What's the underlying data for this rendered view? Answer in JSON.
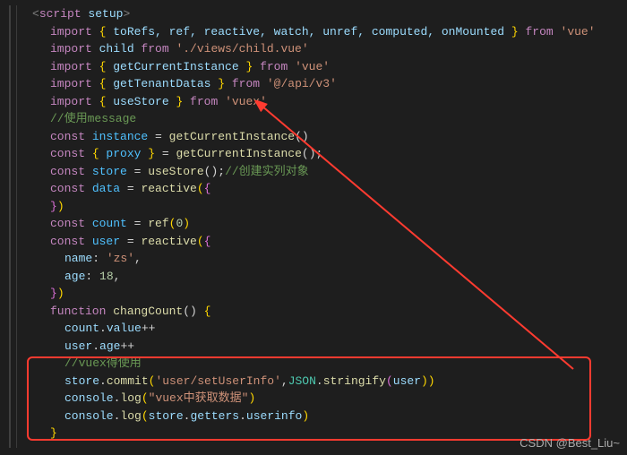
{
  "code": {
    "l1": {
      "tag_open": "<",
      "tag": "script",
      "attr": " setup",
      "tag_close": ">"
    },
    "l2": {
      "imp": "import",
      "b1": " { ",
      "names": "toRefs, ref, reactive, watch, unref, computed, onMounted",
      "b2": " } ",
      "from": "from ",
      "mod": "'vue'"
    },
    "l3": {
      "imp": "import",
      "name": " child ",
      "from": "from ",
      "mod": "'./views/child.vue'"
    },
    "l4": {
      "imp": "import",
      "b1": " { ",
      "names": "getCurrentInstance",
      "b2": " } ",
      "from": "from ",
      "mod": "'vue'"
    },
    "l5": {
      "imp": "import",
      "b1": " { ",
      "names": "getTenantDatas",
      "b2": " } ",
      "from": "from ",
      "mod": "'@/api/v3'"
    },
    "l6": {
      "imp": "import",
      "b1": " { ",
      "names": "useStore",
      "b2": " } ",
      "from": "from ",
      "mod": "'vuex'"
    },
    "l7": {
      "c": "//使用message"
    },
    "l8": {
      "kw": "const ",
      "v": "instance",
      "eq": " = ",
      "fn": "getCurrentInstance",
      "call": "()"
    },
    "l9": {
      "kw": "const ",
      "b1": "{ ",
      "v": "proxy",
      "b2": " }",
      "eq": " = ",
      "fn": "getCurrentInstance",
      "call": "();"
    },
    "l10": {
      "kw": "const ",
      "v": "store",
      "eq": " = ",
      "fn": "useStore",
      "call": "();",
      "c": "//创建实列对象"
    },
    "l11": {
      "kw": "const ",
      "v": "data",
      "eq": " = ",
      "fn": "reactive",
      "p1": "(",
      "b1": "{"
    },
    "l12": "",
    "l13": {
      "b2": "}",
      "p2": ")"
    },
    "l14": {
      "kw": "const ",
      "v": "count",
      "eq": " = ",
      "fn": "ref",
      "p1": "(",
      "n": "0",
      "p2": ")"
    },
    "l15": {
      "kw": "const ",
      "v": "user",
      "eq": " = ",
      "fn": "reactive",
      "p1": "(",
      "b1": "{"
    },
    "l16": {
      "k": "name",
      "c": ": ",
      "s": "'zs'",
      "comma": ","
    },
    "l17": {
      "k": "age",
      "c": ": ",
      "n": "18",
      "comma": ","
    },
    "l18": {
      "b2": "}",
      "p2": ")"
    },
    "l19": {
      "kw": "function ",
      "fn": "changCount",
      "p": "() ",
      "b1": "{"
    },
    "l20": {
      "v": "count",
      "d": ".",
      "p": "value",
      "op": "++"
    },
    "l21": {
      "v": "user",
      "d": ".",
      "p": "age",
      "op": "++"
    },
    "l22": {
      "c": "//vuex得使用"
    },
    "l23": {
      "v": "store",
      "d1": ".",
      "m": "commit",
      "p1": "(",
      "s1": "'user/setUserInfo'",
      "comma": ",",
      "cls": "JSON",
      "d2": ".",
      "m2": "stringify",
      "p2": "(",
      "arg": "user",
      "p3": "))"
    },
    "l24": {
      "v": "console",
      "d1": ".",
      "m": "log",
      "p1": "(",
      "s1": "\"vuex中获取数据\"",
      "p2": ")"
    },
    "l25": {
      "v": "console",
      "d1": ".",
      "m": "log",
      "p1": "(",
      "arg1": "store",
      "d2": ".",
      "arg2": "getters",
      "d3": ".",
      "arg3": "userinfo",
      "p2": ")"
    },
    "l26": {
      "b": "}"
    }
  },
  "watermark": "CSDN @Best_Liu~"
}
